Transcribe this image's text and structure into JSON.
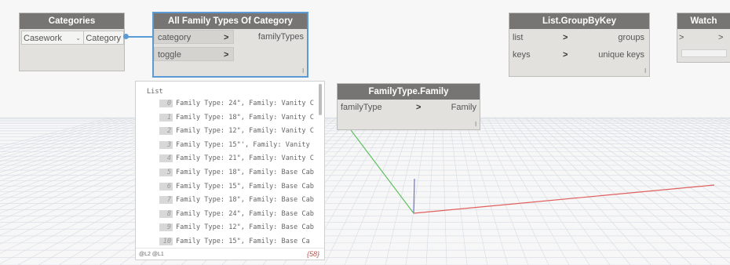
{
  "nodes": {
    "categories": {
      "title": "Categories",
      "dropdown_value": "Casework",
      "output": "Category"
    },
    "all_family_types": {
      "title": "All Family Types Of Category",
      "inputs": [
        "category",
        "toggle"
      ],
      "output": "familyTypes",
      "lacing": "l"
    },
    "family_type_family": {
      "title": "FamilyType.Family",
      "input": "familyType",
      "output": "Family",
      "lacing": "l"
    },
    "group_by_key": {
      "title": "List.GroupByKey",
      "inputs": [
        "list",
        "keys"
      ],
      "outputs": [
        "groups",
        "unique keys"
      ],
      "lacing": "l"
    },
    "watch": {
      "title": "Watch",
      "in_port": ">",
      "out_port": ">"
    }
  },
  "preview": {
    "header": "List",
    "items": [
      {
        "index": "0",
        "text": "Family Type: 24\", Family: Vanity C"
      },
      {
        "index": "1",
        "text": "Family Type: 18\", Family: Vanity C"
      },
      {
        "index": "2",
        "text": "Family Type: 12\", Family: Vanity C"
      },
      {
        "index": "3",
        "text": "Family Type: 15\"', Family: Vanity"
      },
      {
        "index": "4",
        "text": "Family Type: 21\", Family: Vanity C"
      },
      {
        "index": "5",
        "text": "Family Type: 18\", Family: Base Cab"
      },
      {
        "index": "6",
        "text": "Family Type: 15\", Family: Base Cab"
      },
      {
        "index": "7",
        "text": "Family Type: 18\", Family: Base Cab"
      },
      {
        "index": "8",
        "text": "Family Type: 24\", Family: Base Cab"
      },
      {
        "index": "9",
        "text": "Family Type: 12\", Family: Base Cab"
      },
      {
        "index": "10",
        "text": "Family Type: 15\", Family: Base Ca"
      }
    ],
    "levels": "@L2 @L1",
    "count": "{58}"
  },
  "colors": {
    "node_header": "#767573",
    "node_body": "#e2e1dd",
    "wire": "#5b9bd5",
    "selection": "#5b9bd5",
    "axis_x": "#e06060",
    "axis_y": "#7070e0",
    "axis_z": "#60c060"
  }
}
